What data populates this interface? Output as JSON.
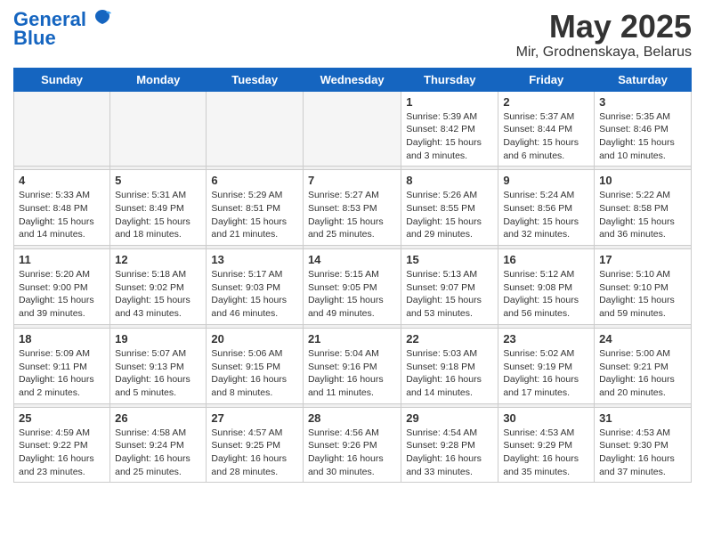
{
  "logo": {
    "line1": "General",
    "line2": "Blue"
  },
  "title": "May 2025",
  "subtitle": "Mir, Grodnenskaya, Belarus",
  "weekdays": [
    "Sunday",
    "Monday",
    "Tuesday",
    "Wednesday",
    "Thursday",
    "Friday",
    "Saturday"
  ],
  "weeks": [
    [
      {
        "day": "",
        "info": ""
      },
      {
        "day": "",
        "info": ""
      },
      {
        "day": "",
        "info": ""
      },
      {
        "day": "",
        "info": ""
      },
      {
        "day": "1",
        "info": "Sunrise: 5:39 AM\nSunset: 8:42 PM\nDaylight: 15 hours\nand 3 minutes."
      },
      {
        "day": "2",
        "info": "Sunrise: 5:37 AM\nSunset: 8:44 PM\nDaylight: 15 hours\nand 6 minutes."
      },
      {
        "day": "3",
        "info": "Sunrise: 5:35 AM\nSunset: 8:46 PM\nDaylight: 15 hours\nand 10 minutes."
      }
    ],
    [
      {
        "day": "4",
        "info": "Sunrise: 5:33 AM\nSunset: 8:48 PM\nDaylight: 15 hours\nand 14 minutes."
      },
      {
        "day": "5",
        "info": "Sunrise: 5:31 AM\nSunset: 8:49 PM\nDaylight: 15 hours\nand 18 minutes."
      },
      {
        "day": "6",
        "info": "Sunrise: 5:29 AM\nSunset: 8:51 PM\nDaylight: 15 hours\nand 21 minutes."
      },
      {
        "day": "7",
        "info": "Sunrise: 5:27 AM\nSunset: 8:53 PM\nDaylight: 15 hours\nand 25 minutes."
      },
      {
        "day": "8",
        "info": "Sunrise: 5:26 AM\nSunset: 8:55 PM\nDaylight: 15 hours\nand 29 minutes."
      },
      {
        "day": "9",
        "info": "Sunrise: 5:24 AM\nSunset: 8:56 PM\nDaylight: 15 hours\nand 32 minutes."
      },
      {
        "day": "10",
        "info": "Sunrise: 5:22 AM\nSunset: 8:58 PM\nDaylight: 15 hours\nand 36 minutes."
      }
    ],
    [
      {
        "day": "11",
        "info": "Sunrise: 5:20 AM\nSunset: 9:00 PM\nDaylight: 15 hours\nand 39 minutes."
      },
      {
        "day": "12",
        "info": "Sunrise: 5:18 AM\nSunset: 9:02 PM\nDaylight: 15 hours\nand 43 minutes."
      },
      {
        "day": "13",
        "info": "Sunrise: 5:17 AM\nSunset: 9:03 PM\nDaylight: 15 hours\nand 46 minutes."
      },
      {
        "day": "14",
        "info": "Sunrise: 5:15 AM\nSunset: 9:05 PM\nDaylight: 15 hours\nand 49 minutes."
      },
      {
        "day": "15",
        "info": "Sunrise: 5:13 AM\nSunset: 9:07 PM\nDaylight: 15 hours\nand 53 minutes."
      },
      {
        "day": "16",
        "info": "Sunrise: 5:12 AM\nSunset: 9:08 PM\nDaylight: 15 hours\nand 56 minutes."
      },
      {
        "day": "17",
        "info": "Sunrise: 5:10 AM\nSunset: 9:10 PM\nDaylight: 15 hours\nand 59 minutes."
      }
    ],
    [
      {
        "day": "18",
        "info": "Sunrise: 5:09 AM\nSunset: 9:11 PM\nDaylight: 16 hours\nand 2 minutes."
      },
      {
        "day": "19",
        "info": "Sunrise: 5:07 AM\nSunset: 9:13 PM\nDaylight: 16 hours\nand 5 minutes."
      },
      {
        "day": "20",
        "info": "Sunrise: 5:06 AM\nSunset: 9:15 PM\nDaylight: 16 hours\nand 8 minutes."
      },
      {
        "day": "21",
        "info": "Sunrise: 5:04 AM\nSunset: 9:16 PM\nDaylight: 16 hours\nand 11 minutes."
      },
      {
        "day": "22",
        "info": "Sunrise: 5:03 AM\nSunset: 9:18 PM\nDaylight: 16 hours\nand 14 minutes."
      },
      {
        "day": "23",
        "info": "Sunrise: 5:02 AM\nSunset: 9:19 PM\nDaylight: 16 hours\nand 17 minutes."
      },
      {
        "day": "24",
        "info": "Sunrise: 5:00 AM\nSunset: 9:21 PM\nDaylight: 16 hours\nand 20 minutes."
      }
    ],
    [
      {
        "day": "25",
        "info": "Sunrise: 4:59 AM\nSunset: 9:22 PM\nDaylight: 16 hours\nand 23 minutes."
      },
      {
        "day": "26",
        "info": "Sunrise: 4:58 AM\nSunset: 9:24 PM\nDaylight: 16 hours\nand 25 minutes."
      },
      {
        "day": "27",
        "info": "Sunrise: 4:57 AM\nSunset: 9:25 PM\nDaylight: 16 hours\nand 28 minutes."
      },
      {
        "day": "28",
        "info": "Sunrise: 4:56 AM\nSunset: 9:26 PM\nDaylight: 16 hours\nand 30 minutes."
      },
      {
        "day": "29",
        "info": "Sunrise: 4:54 AM\nSunset: 9:28 PM\nDaylight: 16 hours\nand 33 minutes."
      },
      {
        "day": "30",
        "info": "Sunrise: 4:53 AM\nSunset: 9:29 PM\nDaylight: 16 hours\nand 35 minutes."
      },
      {
        "day": "31",
        "info": "Sunrise: 4:53 AM\nSunset: 9:30 PM\nDaylight: 16 hours\nand 37 minutes."
      }
    ]
  ]
}
